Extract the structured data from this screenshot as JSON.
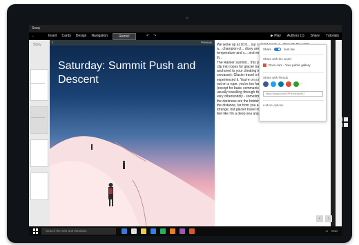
{
  "titlebar": {
    "title": "Sway"
  },
  "ribbon": {
    "back_label": "←",
    "menu": [
      "Insert",
      "Cards",
      "Design",
      "Navigation"
    ],
    "remix_label": "Remix!",
    "undo_icon": "↶",
    "redo_icon": "↷",
    "play_label": "▶ Play",
    "authors_label": "Authors (1)",
    "share_label": "Share",
    "tutorials_label": "Tutorials"
  },
  "left_panel": {
    "label": "Story"
  },
  "story_header": {
    "arrow": "›",
    "preview_label": "Preview"
  },
  "hero": {
    "title": "Saturday: Summit Push and Descent"
  },
  "article": {
    "paragraph1": "We woke up at 10:0... our summit push. I... through the night a... champion-cl... dicey areas. The d... degree...Fahrenhe... temperature and c... and we began our c... dramatic view of th...",
    "paragraph2": "The Rainier summit... this part of the climb... harnesses and clip into ropes for glacier travel (the idea is that you are anchored to your climbing team in case you fell into a crevasse). Glacier travel is hard to describe if you've never experienced it. You're on a rope, but since you are all spaced out on a rope, you're too far away to actually talk to anyone (except for basic communications like stop/go). You're also usually travelling through the middle of the night, so it can feel very otherworldly - sometimes the only thing that cuts through the darkness are the bobbing headlamps of your teammates in the distance, far from you and far from each other. Sounds strange, but glacier travel in the wee hours always makes me feel like I'm a deep sea anglier fish."
  },
  "share_panel": {
    "share_label": "Share",
    "toggle_label": "Just me",
    "world_heading": "Share with the world",
    "doc_label": "Docs.com - Your public gallery",
    "friends_heading": "Share with friends",
    "link_value": "https://sway.com/SPPs4nk9y9lEJ",
    "more_options": "More options",
    "icon_colors": [
      "#3b5998",
      "#1da1f2",
      "#0077b5",
      "#dd4b39",
      "#2ca02c"
    ]
  },
  "nav_buttons": [
    "‹",
    "›"
  ],
  "taskbar": {
    "search_placeholder": "Search the web and Windows",
    "app_colors": [
      "#3a7bd5",
      "#e0e0e0",
      "#f2c94c",
      "#2f80ed",
      "#27ae60",
      "#e67e22",
      "#9b59b6",
      "#d45a2b"
    ],
    "tray_text": "ENG"
  }
}
